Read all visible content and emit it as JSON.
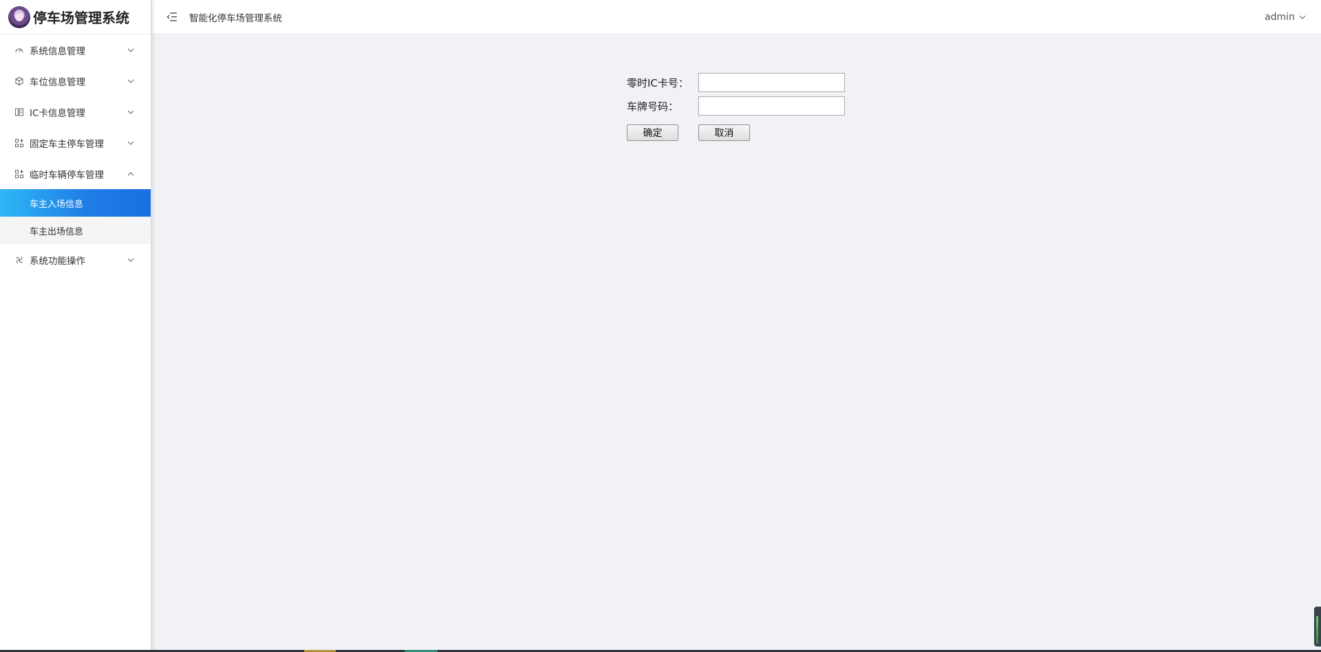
{
  "sidebar": {
    "logo_text": "停车场管理系统",
    "menu": [
      {
        "label": "系统信息管理",
        "icon": "dashboard-icon",
        "expanded": false
      },
      {
        "label": "车位信息管理",
        "icon": "cube-icon",
        "expanded": false
      },
      {
        "label": "IC卡信息管理",
        "icon": "card-icon",
        "expanded": false
      },
      {
        "label": "固定车主停车管理",
        "icon": "grid-icon",
        "expanded": false
      },
      {
        "label": "临时车辆停车管理",
        "icon": "grid-icon",
        "expanded": true,
        "children": [
          {
            "label": "车主入场信息",
            "active": true
          },
          {
            "label": "车主出场信息",
            "active": false
          }
        ]
      },
      {
        "label": "系统功能操作",
        "icon": "fan-icon",
        "expanded": false
      }
    ]
  },
  "header": {
    "title": "智能化停车场管理系统",
    "user": "admin"
  },
  "form": {
    "ic_card_label": "零时IC卡号：",
    "ic_card_value": "",
    "plate_label": "车牌号码：",
    "plate_value": "",
    "confirm_label": "确定",
    "cancel_label": "取消"
  },
  "colors": {
    "active_gradient_start": "#2eb8f5",
    "active_gradient_end": "#1a6fe0",
    "background": "#f0f2f5"
  }
}
